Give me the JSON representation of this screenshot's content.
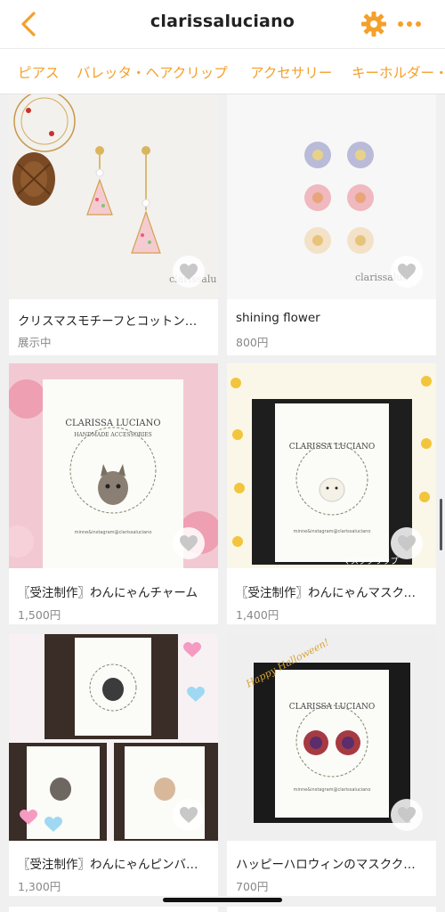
{
  "header": {
    "title": "clarissaluciano",
    "back_icon": "chevron-left-icon",
    "settings_icon": "gear-icon",
    "more_icon": "more-horizontal-icon",
    "accent_color": "#f4a02b"
  },
  "tabs": [
    {
      "label": "ピアス"
    },
    {
      "label": "バレッタ・ヘアクリップ"
    },
    {
      "label": "アクセサリー"
    },
    {
      "label": "キーホルダー・"
    }
  ],
  "products": [
    {
      "name": "クリスマスモチーフとコットン…",
      "price": "展示中"
    },
    {
      "name": "shining flower",
      "price": "800円"
    },
    {
      "name": "〖受注制作〗わんにゃんチャーム",
      "price": "1,500円"
    },
    {
      "name": "〖受注制作〗わんにゃんマスクク…",
      "price": "1,400円"
    },
    {
      "name": "〖受注制作〗わんにゃんピンバッジ",
      "price": "1,300円"
    },
    {
      "name": "ハッピーハロウィンのマスクク…",
      "price": "700円"
    }
  ],
  "image_text": {
    "watermark_1": "clarissalu",
    "watermark_2": "clarissaluc",
    "card_brand": "CLARISSA LUCIANO",
    "card_sub": "HANDMADE ACCESSORIES",
    "card_footer": "minne&instagram@clarissaluciano",
    "mask_clip": "マスククリップ",
    "halloween": "Happy Halloween!"
  }
}
